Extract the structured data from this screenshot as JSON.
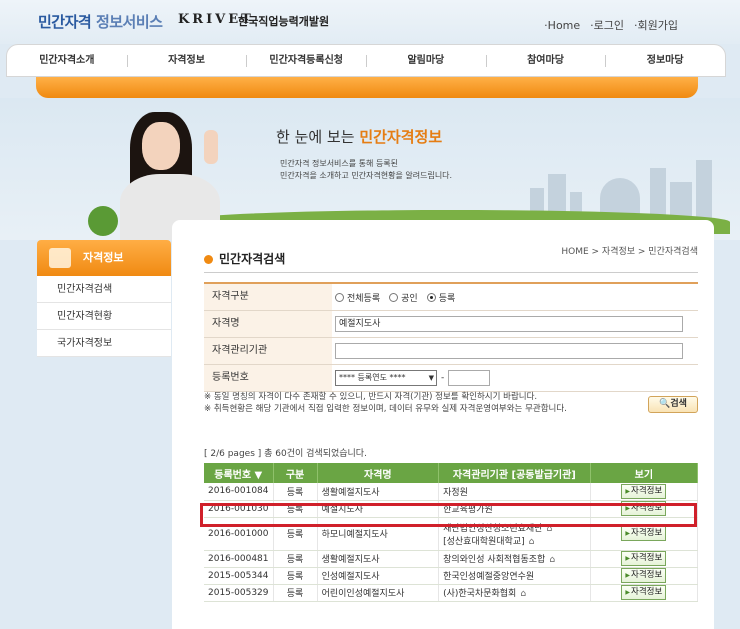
{
  "header": {
    "logo_main": "민간자격",
    "logo_sub": "정보서비스",
    "krivet": "KRIVET",
    "krivet_kr": "한국직업능력개발원",
    "util": [
      "·Home",
      "·로그인",
      "·회원가입"
    ]
  },
  "gnb": [
    "민간자격소개",
    "자격정보",
    "민간자격등록신청",
    "알림마당",
    "참여마당",
    "정보마당"
  ],
  "hero": {
    "title_pre": "한 눈에 보는 ",
    "title_hl": "민간자격정보",
    "desc_line1": "민간자격 정보서비스를 통해 등록된",
    "desc_line2": "민간자격을 소개하고 민간자격현황을 알려드립니다."
  },
  "sidebar": {
    "title": "자격정보",
    "items": [
      "민간자격검색",
      "민간자격현황",
      "국가자격정보"
    ]
  },
  "page": {
    "title": "민간자격검색",
    "breadcrumb": "HOME > 자격정보 > 민간자격검색"
  },
  "form": {
    "type_label": "자격구분",
    "type_options": [
      "전체등록",
      "공인",
      "등록"
    ],
    "type_selected": "등록",
    "name_label": "자격명",
    "name_value": "예절지도사",
    "org_label": "자격관리기관",
    "org_value": "",
    "regno_label": "등록번호",
    "regno_select": "**** 등록연도 ****",
    "regno_dash": "-",
    "note1": "※ 동일 명칭의 자격이 다수 존재할 수 있으니, 반드시 자격(기관) 정보를 확인하시기 바랍니다.",
    "note2": "※ 취득현황은 해당 기관에서 직접 입력한 정보이며, 데이터 유무와 실제 자격운영여부와는 무관합니다.",
    "search_button": "검색"
  },
  "results": {
    "count_text": "[ 2/6 pages ] 총 60건이 검색되었습니다.",
    "headers": [
      "등록번호 ▼",
      "구분",
      "자격명",
      "자격관리기관 [공동발급기관]",
      "보기"
    ],
    "view_label": "자격정보",
    "rows": [
      {
        "no": "2016-001084",
        "type": "등록",
        "name": "생활예절지도사",
        "org": "자정원",
        "org2": "",
        "home": false
      },
      {
        "no": "2016-001030",
        "type": "등록",
        "name": "예절지도사",
        "org": "한교육평가원",
        "org2": "",
        "home": false
      },
      {
        "no": "2016-001000",
        "type": "등록",
        "name": "하모니예절지도사",
        "org": "재단법인성산청소년효재단",
        "org2": "[성산효대학원대학교]",
        "home": true
      },
      {
        "no": "2016-000481",
        "type": "등록",
        "name": "생활예절지도사",
        "org": "창의와인성 사회적협동조합",
        "org2": "",
        "home": true
      },
      {
        "no": "2015-005344",
        "type": "등록",
        "name": "인성예절지도사",
        "org": "한국인성예절중앙연수원",
        "org2": "",
        "home": false
      },
      {
        "no": "2015-005329",
        "type": "등록",
        "name": "어린이인성예절지도사",
        "org": "(사)한국차문화협회",
        "org2": "",
        "home": true
      }
    ]
  }
}
